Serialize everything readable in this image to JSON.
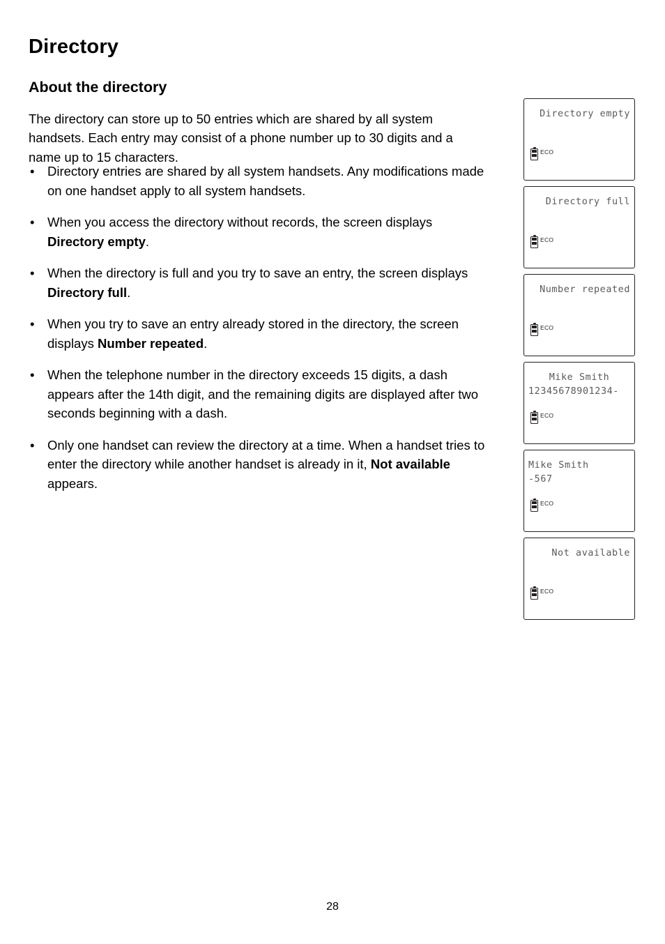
{
  "document": {
    "title": "Directory",
    "section_title": "About the directory",
    "intro": "The directory can store up to 50 entries which are shared by all system handsets. Each entry may consist of a phone number up to 30 digits and a name up to 15 characters.",
    "page_number": "28",
    "bullet_marker": "•"
  },
  "bullets": [
    {
      "parts": [
        {
          "text": "Directory entries are shared by all system handsets. Any modifications made on one handset apply to all system handsets.",
          "bold": false
        }
      ]
    },
    {
      "parts": [
        {
          "text": "When you access the directory without records, the screen displays ",
          "bold": false
        },
        {
          "text": "Directory empty",
          "bold": true
        },
        {
          "text": ".",
          "bold": false
        }
      ]
    },
    {
      "parts": [
        {
          "text": "When the directory is full and you try to save an entry, the screen displays ",
          "bold": false
        },
        {
          "text": "Directory full",
          "bold": true
        },
        {
          "text": ".",
          "bold": false
        }
      ]
    },
    {
      "parts": [
        {
          "text": "When you try to save an entry already stored in the directory, the screen displays ",
          "bold": false
        },
        {
          "text": "Number repeated",
          "bold": true
        },
        {
          "text": ".",
          "bold": false
        }
      ]
    },
    {
      "parts": [
        {
          "text": "When the telephone number in the directory exceeds 15 digits, a dash appears after the 14th digit, and the remaining digits are displayed after two seconds beginning with a dash.",
          "bold": false
        }
      ]
    },
    {
      "parts": [
        {
          "text": "Only one handset can review the directory at a time. When a handset tries to enter the directory while another handset is already in it, ",
          "bold": false
        },
        {
          "text": "Not available",
          "bold": true
        },
        {
          "text": " appears.",
          "bold": false
        }
      ]
    }
  ],
  "screens": [
    {
      "name": "directory-empty",
      "lines": [
        {
          "text": "Directory empty",
          "align": "right"
        }
      ],
      "eco_label": "ECO"
    },
    {
      "name": "directory-full",
      "lines": [
        {
          "text": "Directory full",
          "align": "right"
        }
      ],
      "eco_label": "ECO"
    },
    {
      "name": "number-repeated",
      "lines": [
        {
          "text": "Number repeated",
          "align": "right"
        }
      ],
      "eco_label": "ECO"
    },
    {
      "name": "mike-smith-long-number",
      "lines": [
        {
          "text": "Mike Smith",
          "align": "center"
        },
        {
          "text": "12345678901234-",
          "align": "left"
        }
      ],
      "eco_label": "ECO"
    },
    {
      "name": "mike-smith-remaining-digits",
      "lines": [
        {
          "text": "Mike Smith",
          "align": "left"
        },
        {
          "text": "-567",
          "align": "left"
        }
      ],
      "eco_label": "ECO"
    },
    {
      "name": "not-available",
      "lines": [
        {
          "text": "Not available",
          "align": "right"
        }
      ],
      "eco_label": "ECO"
    }
  ]
}
